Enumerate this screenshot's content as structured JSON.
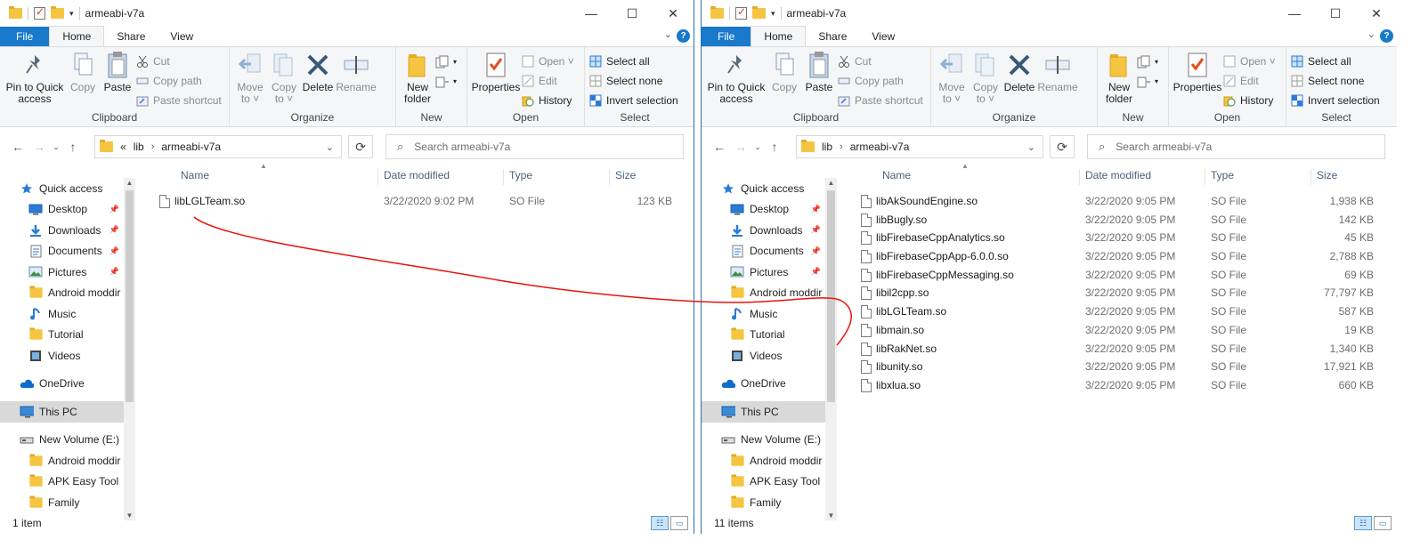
{
  "left": {
    "title": "armeabi-v7a",
    "tabs": {
      "file": "File",
      "home": "Home",
      "share": "Share",
      "view": "View"
    },
    "help": "?",
    "ribbon": {
      "pin": "Pin to Quick\naccess",
      "copy": "Copy",
      "paste": "Paste",
      "cut": "Cut",
      "copy_path": "Copy path",
      "paste_shortcut": "Paste shortcut",
      "clipboard": "Clipboard",
      "move_to": "Move\nto ˅",
      "copy_to": "Copy\nto ˅",
      "delete": "Delete",
      "rename": "Rename",
      "organize": "Organize",
      "new_folder": "New\nfolder",
      "new": "New",
      "properties": "Properties",
      "open": "Open ˅",
      "edit": "Edit",
      "history": "History",
      "open_group": "Open",
      "select_all": "Select all",
      "select_none": "Select none",
      "invert": "Invert selection",
      "select": "Select"
    },
    "address": {
      "lead": "«",
      "crumb1": "lib",
      "crumb2": "armeabi-v7a"
    },
    "search_placeholder": "Search armeabi-v7a",
    "nav": [
      {
        "label": "Quick access",
        "icon": "star-icon",
        "indent": 0
      },
      {
        "label": "Desktop",
        "icon": "desktop-icon",
        "indent": 1,
        "pin": true
      },
      {
        "label": "Downloads",
        "icon": "download-icon",
        "indent": 1,
        "pin": true
      },
      {
        "label": "Documents",
        "icon": "documents-icon",
        "indent": 1,
        "pin": true
      },
      {
        "label": "Pictures",
        "icon": "pictures-icon",
        "indent": 1,
        "pin": true
      },
      {
        "label": "Android moddir",
        "icon": "folder-icon",
        "indent": 1
      },
      {
        "label": "Music",
        "icon": "music-icon",
        "indent": 1
      },
      {
        "label": "Tutorial",
        "icon": "folder-icon",
        "indent": 1
      },
      {
        "label": "Videos",
        "icon": "videos-icon",
        "indent": 1
      },
      {
        "label": "",
        "icon": "",
        "indent": 0,
        "spacer": true
      },
      {
        "label": "OneDrive",
        "icon": "cloud-icon",
        "indent": 0
      },
      {
        "label": "",
        "icon": "",
        "indent": 0,
        "spacer": true
      },
      {
        "label": "This PC",
        "icon": "pc-icon",
        "indent": 0,
        "selected": true
      },
      {
        "label": "",
        "icon": "",
        "indent": 0,
        "spacer": true
      },
      {
        "label": "New Volume (E:)",
        "icon": "drive-icon",
        "indent": 0
      },
      {
        "label": "Android moddir",
        "icon": "folder-icon",
        "indent": 1
      },
      {
        "label": "APK Easy Tool",
        "icon": "folder-icon",
        "indent": 1
      },
      {
        "label": "Family",
        "icon": "folder-icon",
        "indent": 1
      }
    ],
    "columns": {
      "name": "Name",
      "date": "Date modified",
      "type": "Type",
      "size": "Size"
    },
    "files": [
      {
        "name": "libLGLTeam.so",
        "date": "3/22/2020 9:02 PM",
        "type": "SO File",
        "size": "123 KB"
      }
    ],
    "status": "1 item"
  },
  "right": {
    "title": "armeabi-v7a",
    "tabs": {
      "file": "File",
      "home": "Home",
      "share": "Share",
      "view": "View"
    },
    "help": "?",
    "ribbon": {
      "pin": "Pin to Quick\naccess",
      "copy": "Copy",
      "paste": "Paste",
      "cut": "Cut",
      "copy_path": "Copy path",
      "paste_shortcut": "Paste shortcut",
      "clipboard": "Clipboard",
      "move_to": "Move\nto ˅",
      "copy_to": "Copy\nto ˅",
      "delete": "Delete",
      "rename": "Rename",
      "organize": "Organize",
      "new_folder": "New\nfolder",
      "new": "New",
      "properties": "Properties",
      "open": "Open ˅",
      "edit": "Edit",
      "history": "History",
      "open_group": "Open",
      "select_all": "Select all",
      "select_none": "Select none",
      "invert": "Invert selection",
      "select": "Select"
    },
    "address": {
      "lead": "",
      "crumb1": "lib",
      "crumb2": "armeabi-v7a"
    },
    "search_placeholder": "Search armeabi-v7a",
    "nav": [
      {
        "label": "Quick access",
        "icon": "star-icon",
        "indent": 0
      },
      {
        "label": "Desktop",
        "icon": "desktop-icon",
        "indent": 1,
        "pin": true
      },
      {
        "label": "Downloads",
        "icon": "download-icon",
        "indent": 1,
        "pin": true
      },
      {
        "label": "Documents",
        "icon": "documents-icon",
        "indent": 1,
        "pin": true
      },
      {
        "label": "Pictures",
        "icon": "pictures-icon",
        "indent": 1,
        "pin": true
      },
      {
        "label": "Android moddir",
        "icon": "folder-icon",
        "indent": 1
      },
      {
        "label": "Music",
        "icon": "music-icon",
        "indent": 1
      },
      {
        "label": "Tutorial",
        "icon": "folder-icon",
        "indent": 1
      },
      {
        "label": "Videos",
        "icon": "videos-icon",
        "indent": 1
      },
      {
        "label": "",
        "icon": "",
        "indent": 0,
        "spacer": true
      },
      {
        "label": "OneDrive",
        "icon": "cloud-icon",
        "indent": 0
      },
      {
        "label": "",
        "icon": "",
        "indent": 0,
        "spacer": true
      },
      {
        "label": "This PC",
        "icon": "pc-icon",
        "indent": 0,
        "selected": true
      },
      {
        "label": "",
        "icon": "",
        "indent": 0,
        "spacer": true
      },
      {
        "label": "New Volume (E:)",
        "icon": "drive-icon",
        "indent": 0
      },
      {
        "label": "Android moddir",
        "icon": "folder-icon",
        "indent": 1
      },
      {
        "label": "APK Easy Tool",
        "icon": "folder-icon",
        "indent": 1
      },
      {
        "label": "Family",
        "icon": "folder-icon",
        "indent": 1
      }
    ],
    "columns": {
      "name": "Name",
      "date": "Date modified",
      "type": "Type",
      "size": "Size"
    },
    "files": [
      {
        "name": "libAkSoundEngine.so",
        "date": "3/22/2020 9:05 PM",
        "type": "SO File",
        "size": "1,938 KB"
      },
      {
        "name": "libBugly.so",
        "date": "3/22/2020 9:05 PM",
        "type": "SO File",
        "size": "142 KB"
      },
      {
        "name": "libFirebaseCppAnalytics.so",
        "date": "3/22/2020 9:05 PM",
        "type": "SO File",
        "size": "45 KB"
      },
      {
        "name": "libFirebaseCppApp-6.0.0.so",
        "date": "3/22/2020 9:05 PM",
        "type": "SO File",
        "size": "2,788 KB"
      },
      {
        "name": "libFirebaseCppMessaging.so",
        "date": "3/22/2020 9:05 PM",
        "type": "SO File",
        "size": "69 KB"
      },
      {
        "name": "libil2cpp.so",
        "date": "3/22/2020 9:05 PM",
        "type": "SO File",
        "size": "77,797 KB"
      },
      {
        "name": "libLGLTeam.so",
        "date": "3/22/2020 9:05 PM",
        "type": "SO File",
        "size": "587 KB"
      },
      {
        "name": "libmain.so",
        "date": "3/22/2020 9:05 PM",
        "type": "SO File",
        "size": "19 KB"
      },
      {
        "name": "libRakNet.so",
        "date": "3/22/2020 9:05 PM",
        "type": "SO File",
        "size": "1,340 KB"
      },
      {
        "name": "libunity.so",
        "date": "3/22/2020 9:05 PM",
        "type": "SO File",
        "size": "17,921 KB"
      },
      {
        "name": "libxlua.so",
        "date": "3/22/2020 9:05 PM",
        "type": "SO File",
        "size": "660 KB"
      }
    ],
    "status": "11 items"
  },
  "colors": {
    "accent": "#1979ca",
    "annotation": "#e8120c"
  }
}
